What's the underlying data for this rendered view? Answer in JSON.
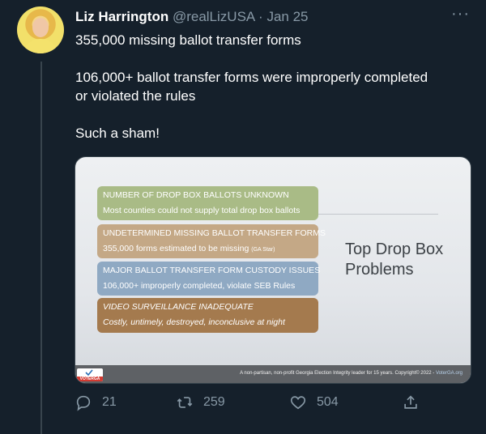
{
  "tweet": {
    "author_name": "Liz Harrington",
    "handle": "@realLizUSA",
    "date_sep": "·",
    "date": "Jan 25",
    "more": "···",
    "text_line1": "355,000 missing ballot transfer forms",
    "text_line2": "106,000+ ballot transfer forms were improperly completed",
    "text_line3": "or violated the rules",
    "text_line4": "Such a sham!"
  },
  "slide": {
    "boxes": [
      {
        "title": "NUMBER OF DROP BOX BALLOTS UNKNOWN",
        "sub": "Most counties could not supply total drop box ballots",
        "color": "#a9bb86"
      },
      {
        "title": "UNDETERMINED MISSING BALLOT TRANSFER FORMS",
        "sub": "355,000 forms estimated to be missing",
        "sub_small": "(GA Star)",
        "color": "#c4a886"
      },
      {
        "title": "MAJOR BALLOT TRANSFER FORM CUSTODY ISSUES",
        "sub": "106,000+ improperly completed, violate SEB Rules",
        "color": "#8fa9c3"
      },
      {
        "title": "VIDEO SURVEILLANCE INADEQUATE",
        "sub": "Costly, untimely, destroyed, inconclusive at night",
        "color": "#a47a4e"
      }
    ],
    "title_line1": "Top Drop Box",
    "title_line2": "Problems",
    "footer_text": "A non-partisan, non-profit Georgia Election Integrity leader for 15 years.  Copyright© 2022 - ",
    "footer_link": "VoterGA.org",
    "logo_text": "VOTERGA"
  },
  "actions": {
    "reply_count": "21",
    "retweet_count": "259",
    "like_count": "504"
  },
  "colors": {
    "background": "#15202b",
    "secondary_text": "#8899a6"
  }
}
